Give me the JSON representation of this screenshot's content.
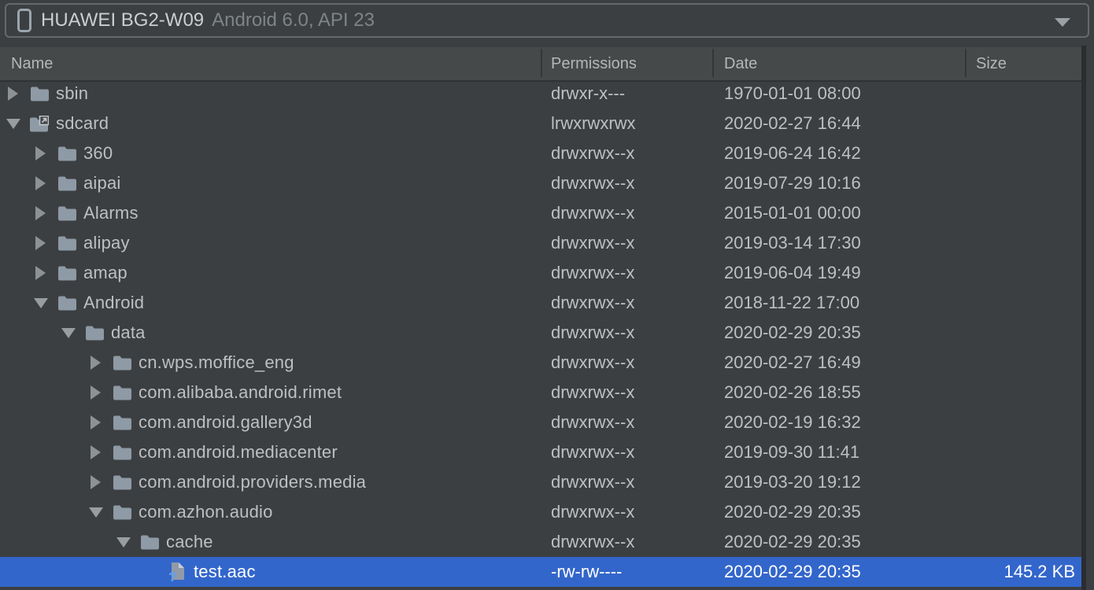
{
  "device_selector": {
    "device_name": "HUAWEI BG2-W09",
    "device_os": "Android 6.0, API 23"
  },
  "table": {
    "columns": [
      "Name",
      "Permissions",
      "Date",
      "Size"
    ]
  },
  "tree_rows": [
    {
      "name": "sbin",
      "depth": 1,
      "state": "collapsed",
      "icon": "folder-icon",
      "permissions": "drwxr-x---",
      "date": "1970-01-01 08:00",
      "size": "",
      "selected": false
    },
    {
      "name": "sdcard",
      "depth": 1,
      "state": "expanded",
      "icon": "folder-symlink-icon",
      "permissions": "lrwxrwxrwx",
      "date": "2020-02-27 16:44",
      "size": "",
      "selected": false
    },
    {
      "name": "360",
      "depth": 2,
      "state": "collapsed",
      "icon": "folder-icon",
      "permissions": "drwxrwx--x",
      "date": "2019-06-24 16:42",
      "size": "",
      "selected": false
    },
    {
      "name": "aipai",
      "depth": 2,
      "state": "collapsed",
      "icon": "folder-icon",
      "permissions": "drwxrwx--x",
      "date": "2019-07-29 10:16",
      "size": "",
      "selected": false
    },
    {
      "name": "Alarms",
      "depth": 2,
      "state": "collapsed",
      "icon": "folder-icon",
      "permissions": "drwxrwx--x",
      "date": "2015-01-01 00:00",
      "size": "",
      "selected": false
    },
    {
      "name": "alipay",
      "depth": 2,
      "state": "collapsed",
      "icon": "folder-icon",
      "permissions": "drwxrwx--x",
      "date": "2019-03-14 17:30",
      "size": "",
      "selected": false
    },
    {
      "name": "amap",
      "depth": 2,
      "state": "collapsed",
      "icon": "folder-icon",
      "permissions": "drwxrwx--x",
      "date": "2019-06-04 19:49",
      "size": "",
      "selected": false
    },
    {
      "name": "Android",
      "depth": 2,
      "state": "expanded",
      "icon": "folder-icon",
      "permissions": "drwxrwx--x",
      "date": "2018-11-22 17:00",
      "size": "",
      "selected": false
    },
    {
      "name": "data",
      "depth": 3,
      "state": "expanded",
      "icon": "folder-icon",
      "permissions": "drwxrwx--x",
      "date": "2020-02-29 20:35",
      "size": "",
      "selected": false
    },
    {
      "name": "cn.wps.moffice_eng",
      "depth": 4,
      "state": "collapsed",
      "icon": "folder-icon",
      "permissions": "drwxrwx--x",
      "date": "2020-02-27 16:49",
      "size": "",
      "selected": false
    },
    {
      "name": "com.alibaba.android.rimet",
      "depth": 4,
      "state": "collapsed",
      "icon": "folder-icon",
      "permissions": "drwxrwx--x",
      "date": "2020-02-26 18:55",
      "size": "",
      "selected": false
    },
    {
      "name": "com.android.gallery3d",
      "depth": 4,
      "state": "collapsed",
      "icon": "folder-icon",
      "permissions": "drwxrwx--x",
      "date": "2020-02-19 16:32",
      "size": "",
      "selected": false
    },
    {
      "name": "com.android.mediacenter",
      "depth": 4,
      "state": "collapsed",
      "icon": "folder-icon",
      "permissions": "drwxrwx--x",
      "date": "2019-09-30 11:41",
      "size": "",
      "selected": false
    },
    {
      "name": "com.android.providers.media",
      "depth": 4,
      "state": "collapsed",
      "icon": "folder-icon",
      "permissions": "drwxrwx--x",
      "date": "2019-03-20 19:12",
      "size": "",
      "selected": false
    },
    {
      "name": "com.azhon.audio",
      "depth": 4,
      "state": "expanded",
      "icon": "folder-icon",
      "permissions": "drwxrwx--x",
      "date": "2020-02-29 20:35",
      "size": "",
      "selected": false
    },
    {
      "name": "cache",
      "depth": 5,
      "state": "expanded",
      "icon": "folder-icon",
      "permissions": "drwxrwx--x",
      "date": "2020-02-29 20:35",
      "size": "",
      "selected": false
    },
    {
      "name": "test.aac",
      "depth": 6,
      "state": "leaf",
      "icon": "unknown-file-icon",
      "permissions": "-rw-rw----",
      "date": "2020-02-29 20:35",
      "size": "145.2 KB",
      "selected": true
    }
  ],
  "colors": {
    "selection_background": "#3366cb",
    "selection_text": "#ffffff",
    "row_text": "#bdc0c2",
    "header_background": "#45494a",
    "page_background": "#3c3f41",
    "folder_icon": "#8e9aa5",
    "unknown_file_question": "#5ea2f5"
  }
}
